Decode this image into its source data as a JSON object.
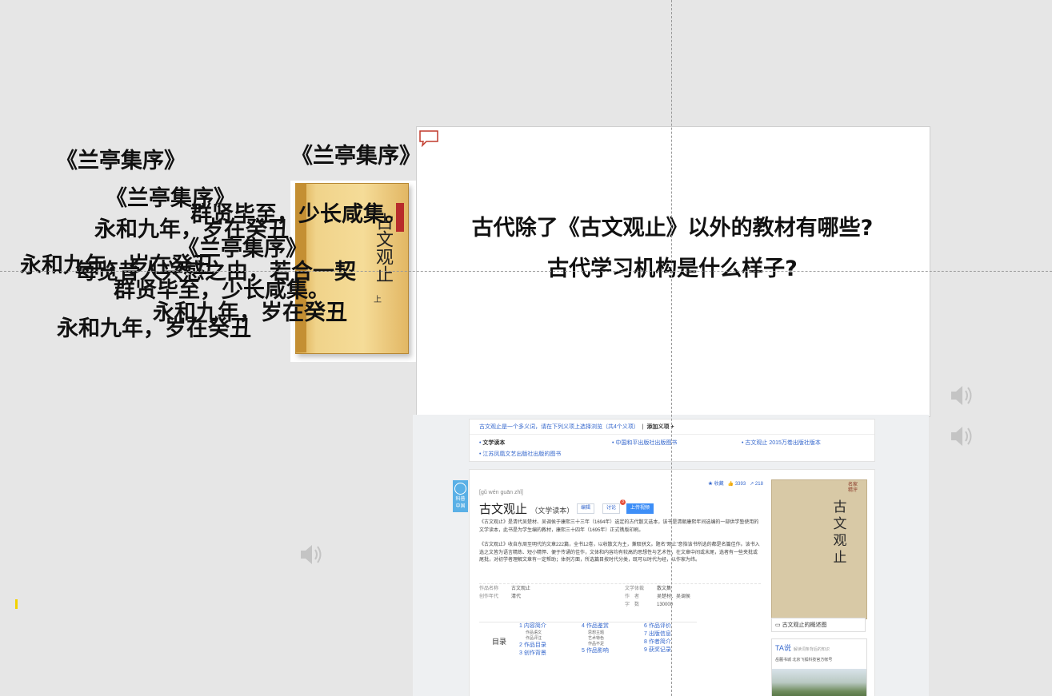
{
  "overlay_texts": {
    "t1": "《兰亭集序》",
    "t2": "《兰亭集序》",
    "t3": "《兰亭集序》",
    "t4": "群贤毕至，少长咸集。",
    "t5": "永和九年，岁在癸丑",
    "t6": "《兰亭集序》",
    "t7": "永和九年，岁在癸丑",
    "t8": "每览昔人兴感之由，若合一契",
    "t9": "群贤毕至，少长咸集。",
    "t10": "永和九年，岁在癸丑",
    "t11": "永和九年，岁在癸丑"
  },
  "book_cover": {
    "title": "古文观止",
    "volume": "上"
  },
  "slide": {
    "question1": "古代除了《古文观止》以外的教材有哪些?",
    "question2": "古代学习机构是什么样子?"
  },
  "icons": {
    "comment": "comment-icon",
    "speaker": "speaker-icon"
  },
  "screenshot": {
    "header_line": "古文观止是一个多义词，请在下列义项上选择浏览（共4个义项）",
    "header_add": "添加义项 +",
    "senses": [
      "文学读本",
      "中国和平出版社出版图书",
      "古文观止 2015万卷出版社版本",
      "江苏凤凰文艺出版社出版的图书"
    ],
    "badge": "科普\n中国",
    "pinyin": "[gǔ wén guān zhǐ]",
    "title": "古文观止",
    "subtitle": "（文学读本）",
    "buttons": {
      "edit": "编辑",
      "discuss": "讨论",
      "discuss_count": "3",
      "upload": "上传视频"
    },
    "stats": {
      "favorite": "收藏",
      "likes": "3393",
      "shares": "218"
    },
    "para1": "《古文观止》是清代吴楚材、吴调侯于康熙三十三年（1694年）选定的古代散文选本，该书是清朝康熙年间选编的一部供学塾使用的文学读本，此书是为学生编的教材，康熙三十四年（1695年）正式镌版印刷。",
    "para2": "《古文观止》收自东周至明代的文章222篇，全书12卷，以收散文为主，兼取骈文。题名“观止”意指该书所选的都是名篇佳作。该书入选之文皆为语言精炼、短小精悍、便于传诵的佳作，文体和内容均有较高的思想性与艺术性，在文章中间或末尾，选者有一些夹批或尾批，对初学者理解文章有一定帮助；体例方面，所选篇目按时代分类，既可以时代为经，以作家为纬。",
    "info": [
      {
        "k": "作品名称",
        "v": "古文观止"
      },
      {
        "k": "创作年代",
        "v": "清代"
      },
      {
        "k": "文学体裁",
        "v": "散文集"
      },
      {
        "k": "作　者",
        "v": "吴楚材、吴调侯"
      },
      {
        "k": "字　数",
        "v": "130000"
      }
    ],
    "toc_label": "目录",
    "toc_col1": [
      "1  内容简介",
      "2  作品目录",
      "3  创作背景"
    ],
    "toc_col1_sub": [
      "作品语文",
      "作品评注"
    ],
    "toc_col2": [
      "4  作品鉴赏",
      "5  作品影响"
    ],
    "toc_col2_sub": [
      "思想主题",
      "艺术特色",
      "作品不足"
    ],
    "toc_col3": [
      "6  作品评价",
      "7  出版信息",
      "8  作者简介",
      "9  获奖记录"
    ],
    "cover_title": "古文观止",
    "cover_tag": "名家精评",
    "cover_caption": "古文观止的概述图",
    "ta_title": "TA说",
    "ta_sub": "解读词条背后的知识",
    "ta_line": "岳麓书城  北京飞狐科技官方帐号"
  }
}
